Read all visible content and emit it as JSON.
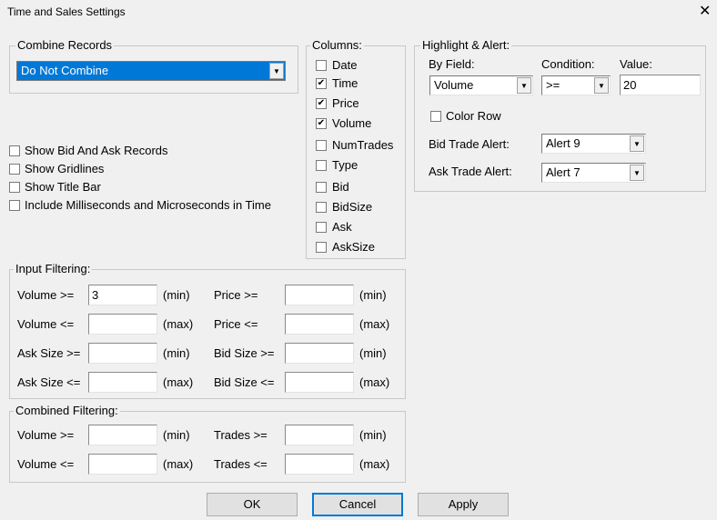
{
  "window": {
    "title": "Time and Sales Settings",
    "close": "✕"
  },
  "combine": {
    "label": "Combine Records",
    "value": "Do Not Combine"
  },
  "options": [
    {
      "label": "Show Bid And Ask Records",
      "checked": false
    },
    {
      "label": "Show Gridlines",
      "checked": false
    },
    {
      "label": "Show Title Bar",
      "checked": false
    },
    {
      "label": "Include Milliseconds and Microseconds in Time",
      "checked": false
    }
  ],
  "columns": {
    "label": "Columns:",
    "items": [
      {
        "label": "Date",
        "checked": false
      },
      {
        "label": "Time",
        "checked": true
      },
      {
        "label": "Price",
        "checked": true
      },
      {
        "label": "Volume",
        "checked": true
      },
      {
        "label": "NumTrades",
        "checked": false
      },
      {
        "label": "Type",
        "checked": false
      },
      {
        "label": "Bid",
        "checked": false
      },
      {
        "label": "BidSize",
        "checked": false
      },
      {
        "label": "Ask",
        "checked": false
      },
      {
        "label": "AskSize",
        "checked": false
      }
    ]
  },
  "highlight": {
    "label": "Highlight & Alert:",
    "by_field_label": "By Field:",
    "by_field": "Volume",
    "condition_label": "Condition:",
    "condition": ">=",
    "value_label": "Value:",
    "value": "20",
    "color_row": "Color Row",
    "bid_alert_label": "Bid Trade Alert:",
    "bid_alert": "Alert 9",
    "ask_alert_label": "Ask Trade Alert:",
    "ask_alert": "Alert 7"
  },
  "input_filtering": {
    "label": "Input Filtering:",
    "rows": [
      {
        "l": "Volume >=",
        "lv": "3",
        "lu": "(min)",
        "r": "Price >=",
        "rv": "",
        "ru": "(min)"
      },
      {
        "l": "Volume <=",
        "lv": "",
        "lu": "(max)",
        "r": "Price <=",
        "rv": "",
        "ru": "(max)"
      },
      {
        "l": "Ask Size >=",
        "lv": "",
        "lu": "(min)",
        "r": "Bid Size >=",
        "rv": "",
        "ru": "(min)"
      },
      {
        "l": "Ask Size <=",
        "lv": "",
        "lu": "(max)",
        "r": "Bid Size <=",
        "rv": "",
        "ru": "(max)"
      }
    ]
  },
  "combined_filtering": {
    "label": "Combined Filtering:",
    "rows": [
      {
        "l": "Volume >=",
        "lv": "",
        "lu": "(min)",
        "r": "Trades >=",
        "rv": "",
        "ru": "(min)"
      },
      {
        "l": "Volume <=",
        "lv": "",
        "lu": "(max)",
        "r": "Trades <=",
        "rv": "",
        "ru": "(max)"
      }
    ]
  },
  "buttons": {
    "ok": "OK",
    "cancel": "Cancel",
    "apply": "Apply"
  }
}
